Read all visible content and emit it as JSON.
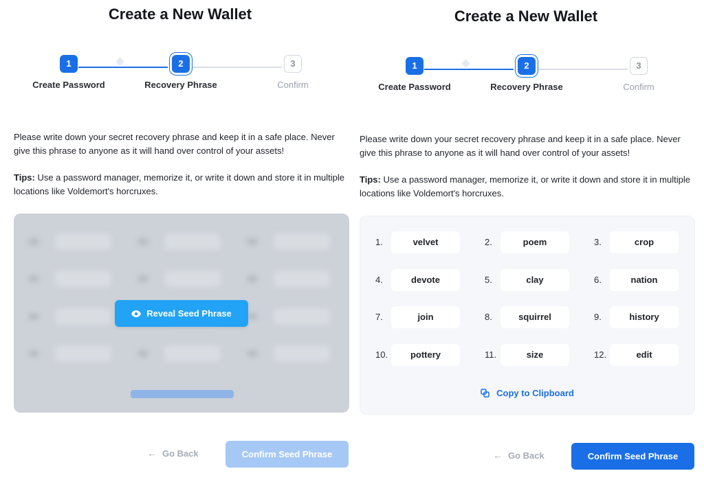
{
  "colors": {
    "accent": "#1a6fe6",
    "reveal_button": "#22a3f5",
    "disabled_button": "#a6c8f4",
    "muted_text": "#9aa1ad"
  },
  "left": {
    "title": "Create a New Wallet",
    "steps": [
      {
        "number": "1",
        "label": "Create Password",
        "state": "done"
      },
      {
        "number": "2",
        "label": "Recovery Phrase",
        "state": "active"
      },
      {
        "number": "3",
        "label": "Confirm",
        "state": "pending"
      }
    ],
    "description": "Please write down your secret recovery phrase and keep it in a safe place. Never give this phrase to anyone as it will hand over control of your assets!",
    "tips_label": "Tips:",
    "tips_text": " Use a password manager, memorize it, or write it down and store it in multiple locations like Voldemort's horcruxes.",
    "reveal_label": "Reveal Seed Phrase",
    "reveal_icon": "eye-icon",
    "back_label": "Go Back",
    "confirm_label": "Confirm Seed Phrase"
  },
  "right": {
    "title": "Create a New Wallet",
    "steps": [
      {
        "number": "1",
        "label": "Create Password",
        "state": "done"
      },
      {
        "number": "2",
        "label": "Recovery Phrase",
        "state": "active"
      },
      {
        "number": "3",
        "label": "Confirm",
        "state": "pending"
      }
    ],
    "description": "Please write down your secret recovery phrase and keep it in a safe place. Never give this phrase to anyone as it will hand over control of your assets!",
    "tips_label": "Tips:",
    "tips_text": " Use a password manager, memorize it, or write it down and store it in multiple locations like Voldemort's horcruxes.",
    "words": [
      {
        "n": "1.",
        "w": "velvet"
      },
      {
        "n": "2.",
        "w": "poem"
      },
      {
        "n": "3.",
        "w": "crop"
      },
      {
        "n": "4.",
        "w": "devote"
      },
      {
        "n": "5.",
        "w": "clay"
      },
      {
        "n": "6.",
        "w": "nation"
      },
      {
        "n": "7.",
        "w": "join"
      },
      {
        "n": "8.",
        "w": "squirrel"
      },
      {
        "n": "9.",
        "w": "history"
      },
      {
        "n": "10.",
        "w": "pottery"
      },
      {
        "n": "11.",
        "w": "size"
      },
      {
        "n": "12.",
        "w": "edit"
      }
    ],
    "copy_label": "Copy to Clipboard",
    "copy_icon": "copy-icon",
    "back_label": "Go Back",
    "confirm_label": "Confirm Seed Phrase"
  }
}
